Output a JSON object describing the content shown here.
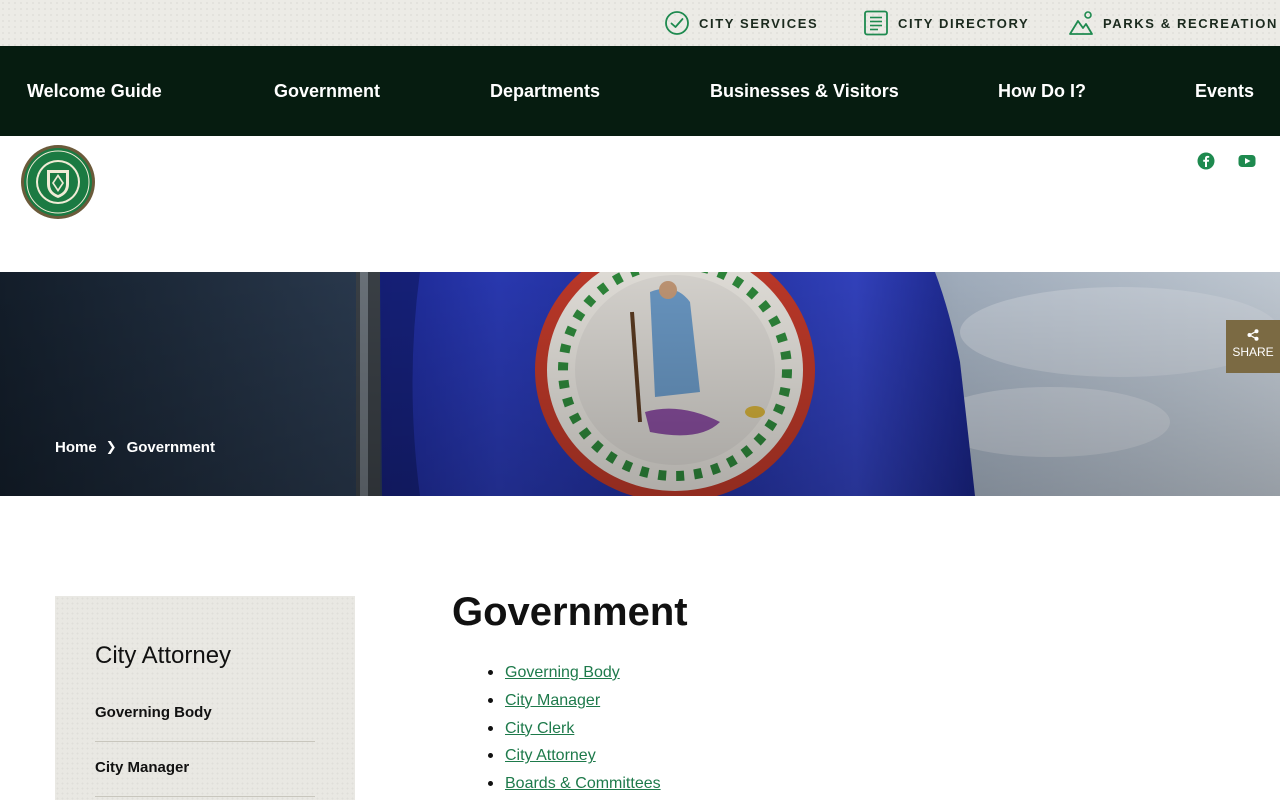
{
  "utility": {
    "links": [
      {
        "label": "CITY SERVICES",
        "icon": "check-circle-icon"
      },
      {
        "label": "CITY DIRECTORY",
        "icon": "document-list-icon"
      },
      {
        "label": "PARKS & RECREATION",
        "icon": "mountain-icon"
      }
    ]
  },
  "nav": {
    "items": [
      "Welcome Guide",
      "Government",
      "Departments",
      "Businesses & Visitors",
      "How Do I?",
      "Events"
    ]
  },
  "header": {
    "social": [
      "facebook-icon",
      "youtube-icon"
    ]
  },
  "breadcrumb": {
    "home": "Home",
    "current": "Government"
  },
  "share": {
    "label": "SHARE"
  },
  "sidebar": {
    "title": "City Attorney",
    "items": [
      "Governing Body",
      "City Manager"
    ]
  },
  "content": {
    "title": "Government",
    "links": [
      "Governing Body",
      "City Manager",
      "City Clerk",
      "City Attorney",
      "Boards & Committees"
    ]
  },
  "colors": {
    "nav_bg": "#061c10",
    "accent_green": "#1e7a4b",
    "share_bg": "#7b6a43"
  }
}
